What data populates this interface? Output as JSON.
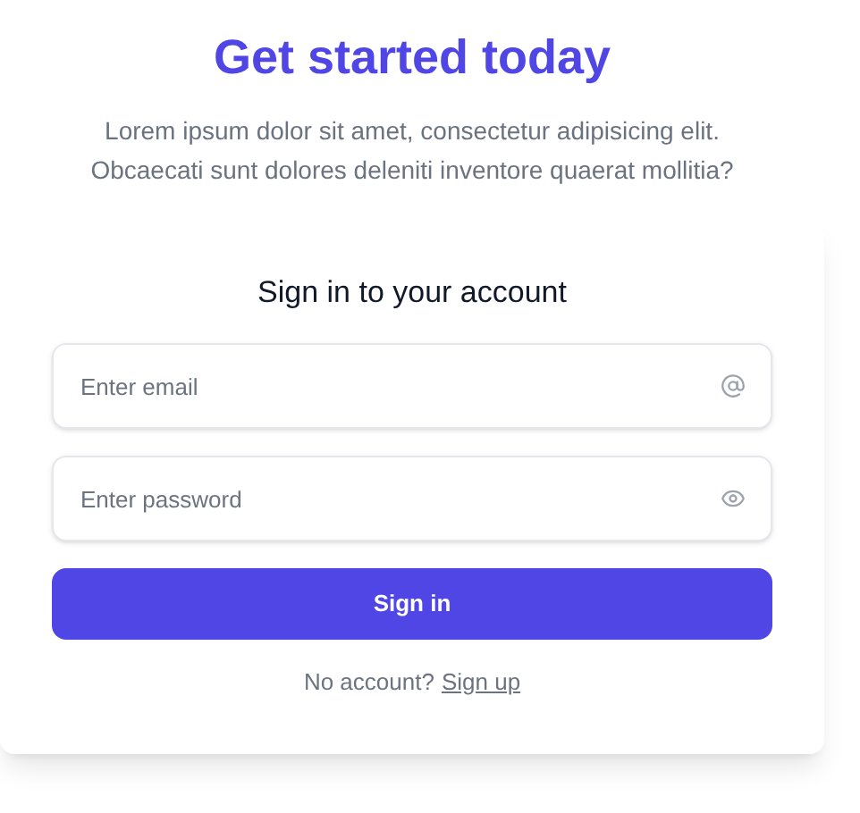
{
  "heading": "Get started today",
  "intro": "Lorem ipsum dolor sit amet, consectetur adipisicing elit. Obcaecati sunt dolores deleniti inventore quaerat mollitia?",
  "form": {
    "title": "Sign in to your account",
    "fields": [
      {
        "kind": "email",
        "placeholder": "Enter email"
      },
      {
        "kind": "password",
        "placeholder": "Enter password"
      }
    ],
    "submit": "Sign in",
    "footer": {
      "text": "No account?",
      "link": "Sign up"
    }
  }
}
